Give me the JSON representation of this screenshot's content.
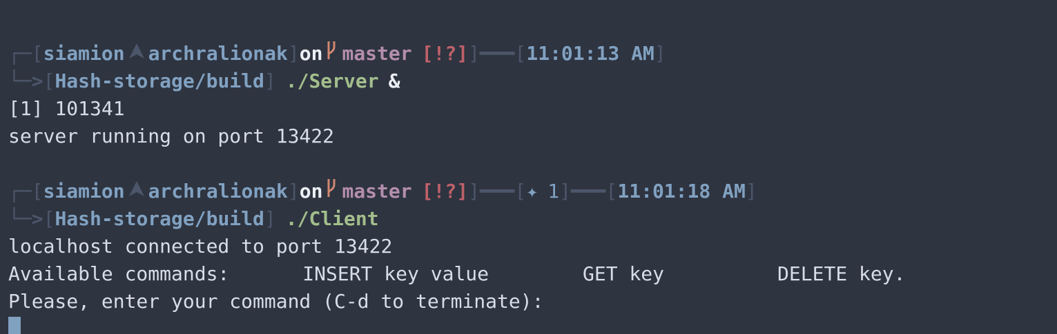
{
  "prompt1": {
    "frame_top": "┌─",
    "bracket_open": "[",
    "user": "siamion",
    "arch_icon": "arch-logo-icon",
    "host": "archralionak",
    "bracket_close": "]",
    "on": "on",
    "branch_icon": "git-branch-icon",
    "branch": "master",
    "status": "[!?]",
    "connector": "]━━━[",
    "time": "11:01:13 AM",
    "time_close": "]",
    "frame_bottom": "└─>",
    "path_open": "[",
    "path": "Hash-storage/build",
    "path_close": "]",
    "command": "./Server",
    "amp": "&"
  },
  "output1": [
    "[1] 101341",
    "server running on port 13422"
  ],
  "prompt2": {
    "frame_top": "┌─",
    "bracket_open": "[",
    "user": "siamion",
    "host": "archralionak",
    "bracket_close": "]",
    "on": "on",
    "branch": "master",
    "status": "[!?]",
    "connector1": "]━━━[",
    "jobs_icon": "✦",
    "jobs_count": "1",
    "connector2": "]━━━[",
    "time": "11:01:18 AM",
    "time_close": "]",
    "frame_bottom": "└─>",
    "path_open": "[",
    "path": "Hash-storage/build",
    "path_close": "]",
    "command": "./Client"
  },
  "output2": {
    "connected": "localhost connected to port 13422",
    "commands_label": "Available commands:",
    "cmd_insert": "INSERT key value",
    "cmd_get": "GET key",
    "cmd_delete": "DELETE key.",
    "prompt": "Please, enter your command (C-d to terminate):"
  },
  "colors": {
    "background": "#2e3440",
    "frame": "#4c566a",
    "user": "#81a1c1",
    "branch": "#b48ead",
    "status": "#bf616a",
    "command": "#a3be8c",
    "text": "#d8dee9",
    "cursor": "#81a1c1"
  }
}
